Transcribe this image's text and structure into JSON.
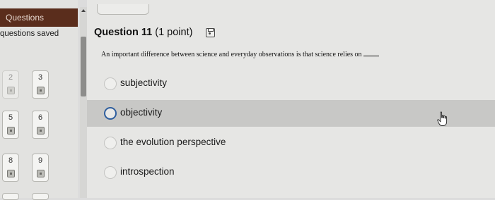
{
  "sidebar": {
    "header": "Questions",
    "saved_text": "questions saved",
    "question_buttons": [
      {
        "number": "2"
      },
      {
        "number": "3"
      },
      {
        "number": "5"
      },
      {
        "number": "6"
      },
      {
        "number": "8"
      },
      {
        "number": "9"
      }
    ]
  },
  "question": {
    "title": "Question 11",
    "points": "(1 point)",
    "text": "An important difference between science and everyday observations is that science relies on",
    "options": [
      {
        "label": "subjectivity",
        "selected": false
      },
      {
        "label": "objectivity",
        "selected": true
      },
      {
        "label": "the evolution perspective",
        "selected": false
      },
      {
        "label": "introspection",
        "selected": false
      }
    ]
  },
  "colors": {
    "sidebar_header": "#5a2d1c",
    "selected_radio": "#2e5e9e",
    "selected_row": "#c8c8c6"
  },
  "icons": {
    "save": "save-icon",
    "cursor": "hand-cursor-icon",
    "flag": "flag-icon",
    "scroll_up": "scroll-up-icon"
  }
}
